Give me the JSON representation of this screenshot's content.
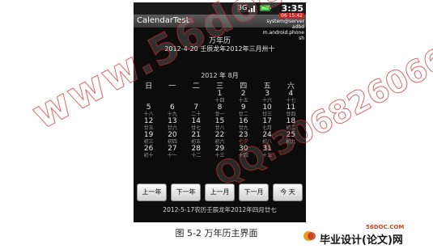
{
  "statusbar": {
    "time": "3:35",
    "signal_icon": "signal-icon",
    "network_label": "3G",
    "battery_icon": "battery-icon"
  },
  "app": {
    "title": "CalendarTest",
    "notifications": [
      "system@server",
      "adbd",
      "m.android.phone",
      "sh"
    ]
  },
  "header": {
    "label": "万年历",
    "date_line": "2012-4-20  壬辰龙年2012年三月卅十"
  },
  "calendar": {
    "month_title": "2012 年  8月",
    "weekdays": [
      "日",
      "一",
      "二",
      "三",
      "四",
      "五",
      "六"
    ],
    "rows": [
      [
        {
          "day": "",
          "lunar": ""
        },
        {
          "day": "",
          "lunar": ""
        },
        {
          "day": "",
          "lunar": ""
        },
        {
          "day": "1",
          "lunar": "十四"
        },
        {
          "day": "2",
          "lunar": "十五"
        },
        {
          "day": "3",
          "lunar": "十六"
        },
        {
          "day": "4",
          "lunar": "十七"
        }
      ],
      [
        {
          "day": "5",
          "lunar": "十八"
        },
        {
          "day": "6",
          "lunar": "十九"
        },
        {
          "day": "7",
          "lunar": "二十"
        },
        {
          "day": "8",
          "lunar": "廿一"
        },
        {
          "day": "9",
          "lunar": "廿二"
        },
        {
          "day": "10",
          "lunar": "廿三"
        },
        {
          "day": "11",
          "lunar": "廿四"
        }
      ],
      [
        {
          "day": "12",
          "lunar": "廿五"
        },
        {
          "day": "13",
          "lunar": "廿六"
        },
        {
          "day": "14",
          "lunar": "廿七"
        },
        {
          "day": "15",
          "lunar": "廿八"
        },
        {
          "day": "16",
          "lunar": "廿九"
        },
        {
          "day": "17",
          "lunar": "七月"
        },
        {
          "day": "18",
          "lunar": "初二"
        }
      ],
      [
        {
          "day": "19",
          "lunar": "初三"
        },
        {
          "day": "20",
          "lunar": "初四"
        },
        {
          "day": "21",
          "lunar": "初五"
        },
        {
          "day": "22",
          "lunar": "初六"
        },
        {
          "day": "23",
          "lunar": "七夕"
        },
        {
          "day": "24",
          "lunar": "初八"
        },
        {
          "day": "25",
          "lunar": "初九"
        }
      ],
      [
        {
          "day": "26",
          "lunar": "初十"
        },
        {
          "day": "27",
          "lunar": "十一"
        },
        {
          "day": "28",
          "lunar": "十二"
        },
        {
          "day": "29",
          "lunar": "十三"
        },
        {
          "day": "30",
          "lunar": "十四"
        },
        {
          "day": "31",
          "lunar": "十五"
        },
        {
          "day": "",
          "lunar": ""
        }
      ]
    ]
  },
  "buttons": {
    "prev_year": "上一年",
    "next_year": "下一年",
    "prev_month": "上一月",
    "next_month": "下一月",
    "today": "今 天"
  },
  "footer": {
    "selected_date": "2012-5-17农历壬辰龙年2012年四月廿七"
  },
  "caption": "图 5-2  万年历主界面",
  "watermarks": {
    "site": "www.56doc.com",
    "qq": "QQ:306826066",
    "logo_small": "56DOC.COM",
    "logo_big": "毕业设计(论文)网"
  },
  "colors": {
    "phone_bg": "#0c0c0c",
    "watermark": "#e03737"
  }
}
